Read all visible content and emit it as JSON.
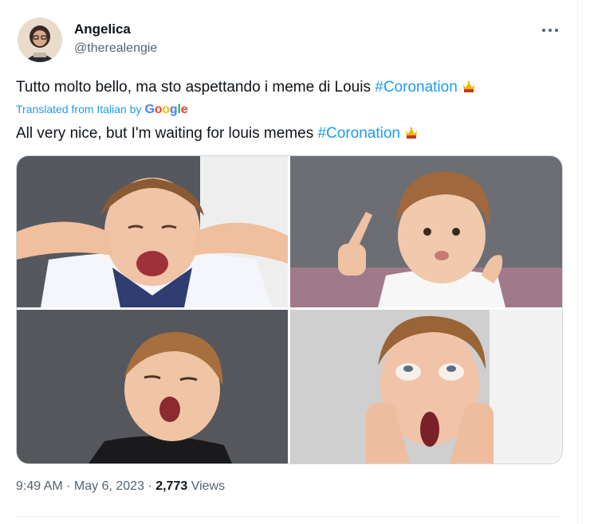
{
  "author": {
    "name": "Angelica",
    "handle": "@therealengie"
  },
  "tweet": {
    "original_text": "Tutto molto bello, ma sto aspettando i meme di Louis ",
    "original_hashtag": "#Coronation",
    "translated_prefix": "Translated from Italian by",
    "translator_brand": [
      "G",
      "o",
      "o",
      "g",
      "l",
      "e"
    ],
    "translated_text": "All very nice, but I'm waiting for louis memes ",
    "translated_hashtag": "#Coronation",
    "emoji": "crown-emoji"
  },
  "media": {
    "photos": [
      {
        "name": "photo-boy-covering-ears"
      },
      {
        "name": "photo-boy-pointing"
      },
      {
        "name": "photo-boy-yawning"
      },
      {
        "name": "photo-boy-hands-on-face"
      }
    ]
  },
  "meta": {
    "time": "9:49 AM",
    "separator": " · ",
    "date": "May 6, 2023",
    "views_count": "2,773",
    "views_label": " Views"
  },
  "icons": {
    "more": "more-horizontal-icon"
  },
  "colors": {
    "link": "#1d9bf0",
    "text": "#0f1419",
    "secondary": "#536471",
    "border": "#cfd9de"
  }
}
